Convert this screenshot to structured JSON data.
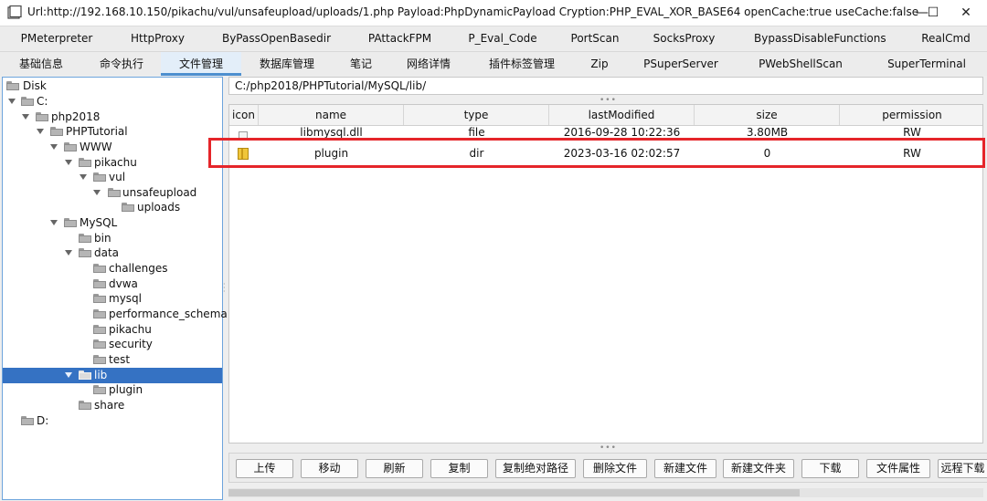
{
  "window": {
    "title": "Url:http://192.168.10.150/pikachu/vul/unsafeupload/uploads/1.php Payload:PhpDynamicPayload Cryption:PHP_EVAL_XOR_BASE64 openCache:true useCache:false",
    "minimize_glyph": "—",
    "maximize_glyph": "☐",
    "close_glyph": "✕"
  },
  "modules_row1": [
    "PMeterpreter",
    "HttpProxy",
    "ByPassOpenBasedir",
    "PAttackFPM",
    "P_Eval_Code",
    "PortScan",
    "SocksProxy",
    "BypassDisableFunctions",
    "RealCmd"
  ],
  "modules_row2": [
    "基础信息",
    "命令执行",
    "文件管理",
    "数据库管理",
    "笔记",
    "网络详情",
    "插件标签管理",
    "Zip",
    "PSuperServer",
    "PWebShellScan",
    "SuperTerminal"
  ],
  "active_tab": "文件管理",
  "tree": [
    {
      "label": "Disk"
    },
    {
      "label": "C:"
    },
    {
      "label": "php2018"
    },
    {
      "label": "PHPTutorial"
    },
    {
      "label": "WWW"
    },
    {
      "label": "pikachu"
    },
    {
      "label": "vul"
    },
    {
      "label": "unsafeupload"
    },
    {
      "label": "uploads"
    },
    {
      "label": "MySQL"
    },
    {
      "label": "bin"
    },
    {
      "label": "data"
    },
    {
      "label": "challenges"
    },
    {
      "label": "dvwa"
    },
    {
      "label": "mysql"
    },
    {
      "label": "performance_schema"
    },
    {
      "label": "pikachu"
    },
    {
      "label": "security"
    },
    {
      "label": "test"
    },
    {
      "label": "lib"
    },
    {
      "label": "plugin"
    },
    {
      "label": "share"
    },
    {
      "label": "D:"
    }
  ],
  "path": "C:/php2018/PHPTutorial/MySQL/lib/",
  "table": {
    "columns": [
      "icon",
      "name",
      "type",
      "lastModified",
      "size",
      "permission"
    ],
    "rows": [
      {
        "name": "libmysql.dll",
        "type": "file",
        "lastModified": "2016-09-28 10:22:36",
        "size": "3.80MB",
        "permission": "RW"
      },
      {
        "name": "plugin",
        "type": "dir",
        "lastModified": "2023-03-16 02:02:57",
        "size": "0",
        "permission": "RW"
      }
    ]
  },
  "buttons": [
    "上传",
    "移动",
    "刷新",
    "复制",
    "复制绝对路径",
    "删除文件",
    "新建文件",
    "新建文件夹",
    "下载",
    "文件属性",
    "远程下载"
  ]
}
